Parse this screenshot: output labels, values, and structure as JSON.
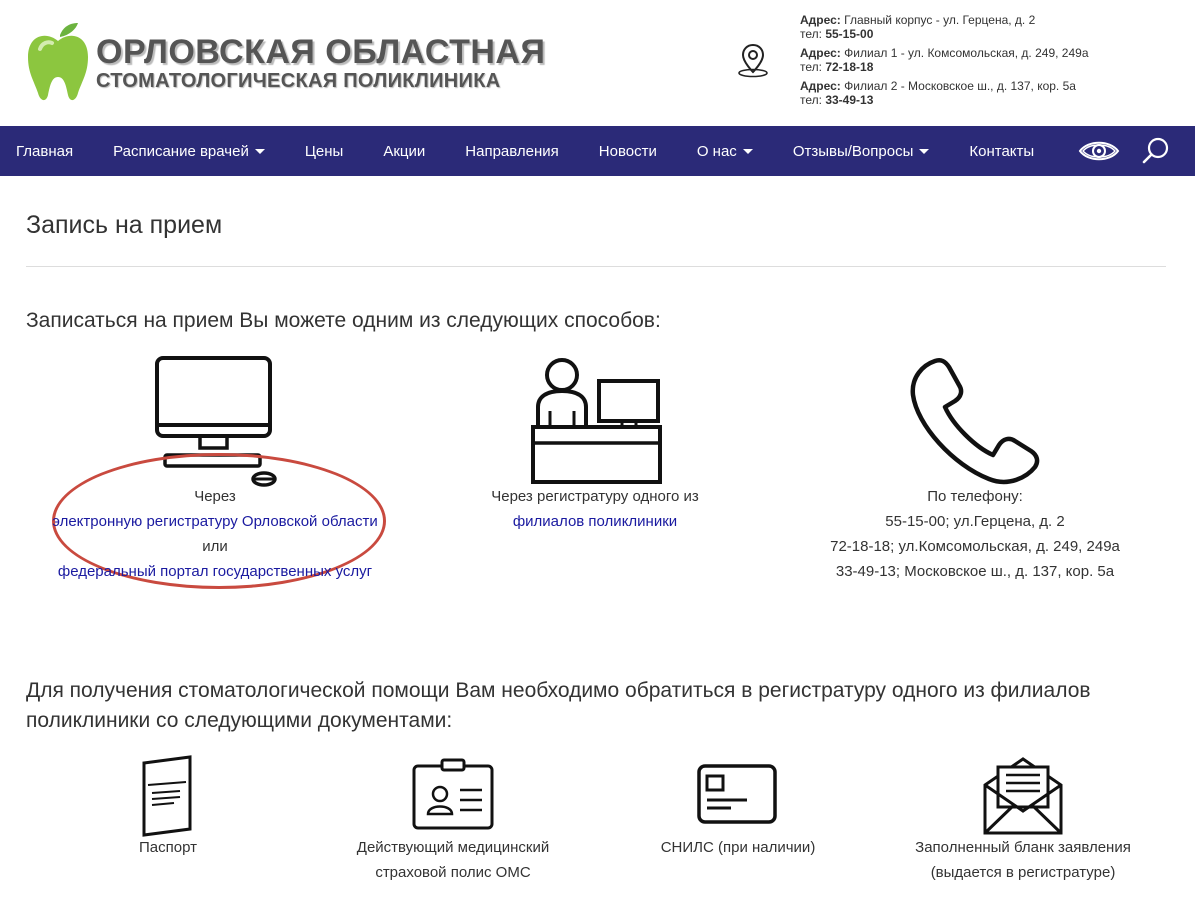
{
  "header": {
    "logo_line1": "ОРЛОВСКАЯ ОБЛАСТНАЯ",
    "logo_line2": "СТОМАТОЛОГИЧЕСКАЯ ПОЛИКЛИНИКА",
    "addresses": [
      {
        "label": "Адрес:",
        "address": "Главный корпус - ул. Герцена, д. 2",
        "tel_label": "тел:",
        "tel": "55-15-00"
      },
      {
        "label": "Адрес:",
        "address": "Филиал 1 - ул. Комсомольская, д. 249, 249а",
        "tel_label": "тел:",
        "tel": "72-18-18"
      },
      {
        "label": "Адрес:",
        "address": "Филиал 2 - Московское ш., д. 137, кор. 5а",
        "tel_label": "тел:",
        "tel": "33-49-13"
      }
    ]
  },
  "nav": {
    "items": [
      {
        "label": "Главная"
      },
      {
        "label": "Расписание врачей"
      },
      {
        "label": "Цены"
      },
      {
        "label": "Акции"
      },
      {
        "label": "Направления"
      },
      {
        "label": "Новости"
      },
      {
        "label": "О нас"
      },
      {
        "label": "Отзывы/Вопросы"
      },
      {
        "label": "Контакты"
      }
    ],
    "icons": [
      "eye-icon",
      "search-icon"
    ]
  },
  "main": {
    "title": "Запись на прием",
    "intro": "Записаться на прием Вы можете одним из следующих способов:",
    "online": {
      "prefix": "Через",
      "link1": "электронную регистратуру Орловской области",
      "or": "или",
      "link2": "федеральный портал государственных услуг"
    },
    "registry": {
      "prefix": "Через регистратуру одного из",
      "link": "филиалов поликлиники"
    },
    "phone": {
      "title": "По телефону:",
      "lines": [
        "55-15-00; ул.Герцена, д. 2",
        "72-18-18; ул.Комсомольская, д. 249, 249а",
        "33-49-13; Московское ш., д. 137, кор. 5а"
      ]
    },
    "docs_intro": "Для получения стоматологической помощи Вам необходимо обратиться в регистратуру одного из филиалов поликлиники со следующими документами:",
    "docs": [
      {
        "line1": "Паспорт",
        "line2": ""
      },
      {
        "line1": "Действующий медицинский",
        "line2": "страховой полис ОМС"
      },
      {
        "line1": "СНИЛС (при наличии)",
        "line2": ""
      },
      {
        "line1": "Заполненный бланк заявления",
        "line2": "(выдается в регистратуре)"
      }
    ]
  },
  "colors": {
    "nav_bg": "#2b2a78",
    "link": "#1a1aa0",
    "ellipse": "#c94a3f",
    "logo_green": "#8cc63f"
  }
}
